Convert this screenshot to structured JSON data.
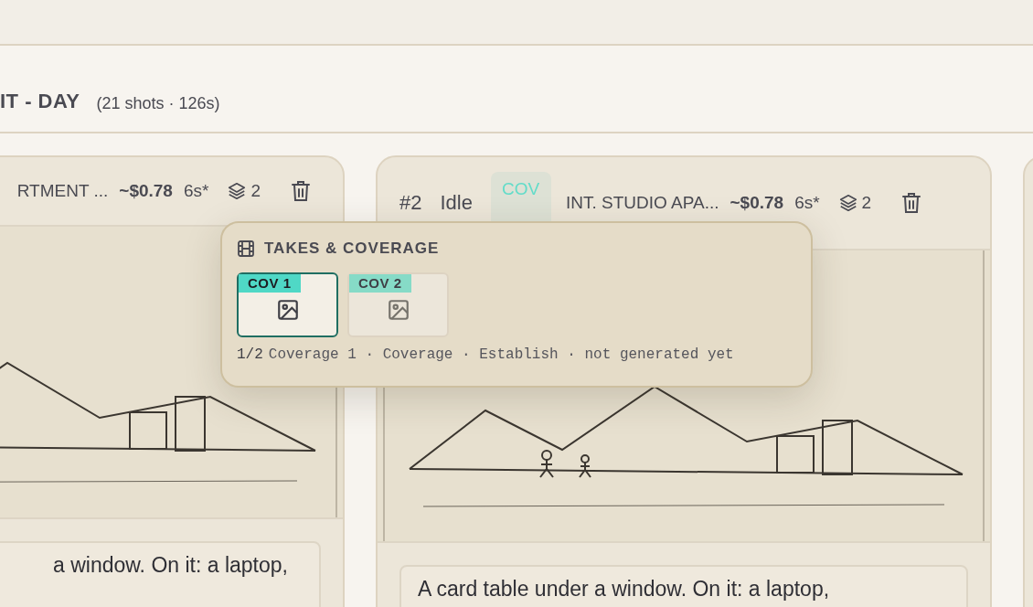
{
  "scene_header": {
    "title": "IT - DAY",
    "meta": "(21 shots · 126s)"
  },
  "shots": [
    {
      "location": "RTMENT ...",
      "cost": "~$0.78",
      "duration": "6s*",
      "takes": "2",
      "description": "a window. On it: a laptop,"
    },
    {
      "number": "#2",
      "status": "Idle",
      "badge": "COV",
      "location": "INT. STUDIO APA...",
      "cost": "~$0.78",
      "duration": "6s*",
      "takes": "2",
      "description": "A card table under a window. On it: a laptop,"
    }
  ],
  "popover": {
    "title": "TAKES & COVERAGE",
    "takes": [
      {
        "label": "COV 1",
        "selected": true
      },
      {
        "label": "COV 2",
        "selected": false
      }
    ],
    "index": "1/2",
    "details": "Coverage 1 · Coverage · Establish · not generated yet"
  }
}
